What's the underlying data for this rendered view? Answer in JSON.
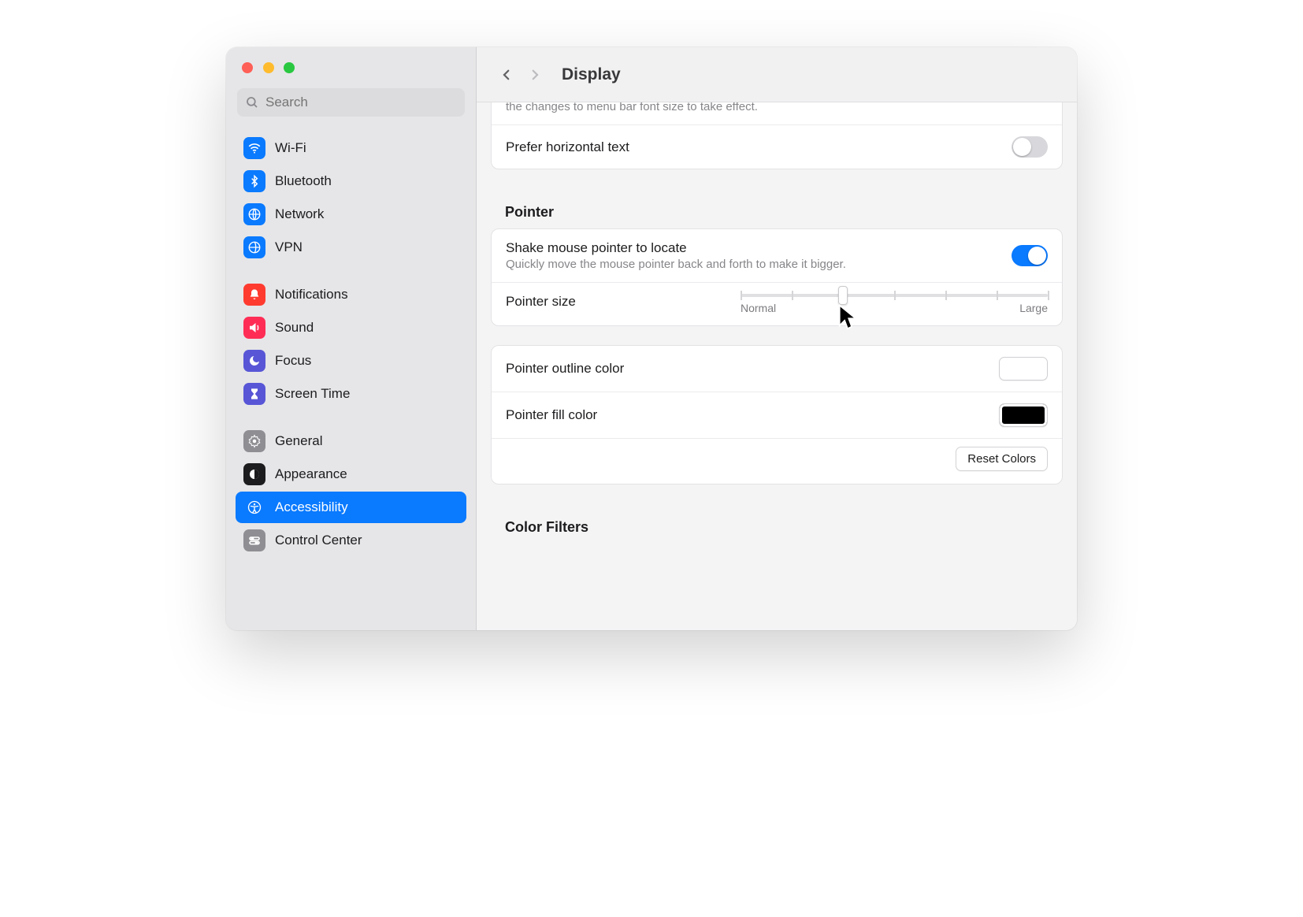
{
  "search": {
    "placeholder": "Search"
  },
  "sidebar": {
    "items": [
      {
        "label": "Wi-Fi"
      },
      {
        "label": "Bluetooth"
      },
      {
        "label": "Network"
      },
      {
        "label": "VPN"
      },
      {
        "label": "Notifications"
      },
      {
        "label": "Sound"
      },
      {
        "label": "Focus"
      },
      {
        "label": "Screen Time"
      },
      {
        "label": "General"
      },
      {
        "label": "Appearance"
      },
      {
        "label": "Accessibility"
      },
      {
        "label": "Control Center"
      }
    ]
  },
  "header": {
    "title": "Display"
  },
  "scrolled_hint": "the changes to menu bar font size to take effect.",
  "prefer_horizontal": {
    "label": "Prefer horizontal text"
  },
  "sections": {
    "pointer_title": "Pointer",
    "color_filters_title": "Color Filters"
  },
  "shake": {
    "label": "Shake mouse pointer to locate",
    "sub": "Quickly move the mouse pointer back and forth to make it bigger."
  },
  "pointer_size": {
    "label": "Pointer size",
    "min_label": "Normal",
    "max_label": "Large"
  },
  "outline_color": {
    "label": "Pointer outline color",
    "value": "#ffffff"
  },
  "fill_color": {
    "label": "Pointer fill color",
    "value": "#000000"
  },
  "reset_colors": {
    "label": "Reset Colors"
  }
}
